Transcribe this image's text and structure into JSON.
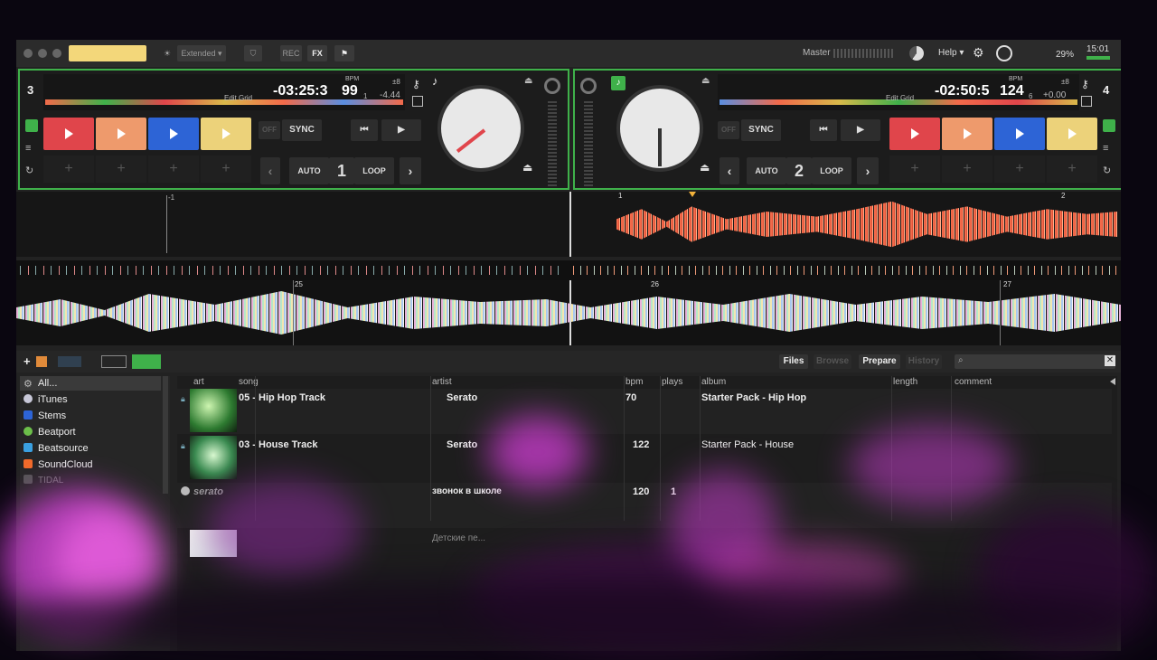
{
  "topbar": {
    "view_mode": "Extended",
    "rec": "REC",
    "fx": "FX",
    "master": "Master",
    "help": "Help",
    "battery": "29%",
    "clock": "15:01"
  },
  "deck_left": {
    "number": "3",
    "edit_grid": "Edit Grid",
    "time": "-03:25:3",
    "bpm_label": "BPM",
    "bpm": "99",
    "bpm_suffix": "1",
    "range": "±8",
    "pitch": "-4.44",
    "off": "OFF",
    "sync": "SYNC",
    "auto": "AUTO",
    "loop_num": "1",
    "loop": "LOOP",
    "pad_colors": [
      "#e0454b",
      "#ee9a6c",
      "#2d64d6",
      "#ecd27a"
    ]
  },
  "deck_right": {
    "number": "4",
    "edit_grid": "Edit Grid",
    "time": "-02:50:5",
    "bpm_label": "BPM",
    "bpm": "124",
    "bpm_suffix": "6",
    "range": "±8",
    "pitch": "+0.00",
    "off": "OFF",
    "sync": "SYNC",
    "auto": "AUTO",
    "loop_num": "2",
    "loop": "LOOP",
    "pad_colors": [
      "#e0454b",
      "#ee9a6c",
      "#2d64d6",
      "#ecd27a"
    ]
  },
  "waveform": {
    "left_beat_marker": "-1",
    "right_beat_marker_1": "1",
    "right_beat_marker_2": "2",
    "overview_marks": [
      "25",
      "26",
      "27"
    ]
  },
  "library": {
    "tabs": {
      "files": "Files",
      "browse": "Browse",
      "prepare": "Prepare",
      "history": "History"
    },
    "search_placeholder": "",
    "sidebar": [
      "All...",
      "iTunes",
      "Stems",
      "Beatport",
      "Beatsource",
      "SoundCloud",
      "TIDAL"
    ],
    "columns": [
      "art",
      "song",
      "artist",
      "bpm",
      "plays",
      "album",
      "length",
      "comment"
    ],
    "rows": [
      {
        "song": "05 - Hip Hop Track",
        "artist": "Serato",
        "bpm": "70",
        "plays": "",
        "album": "Starter Pack - Hip Hop"
      },
      {
        "song": "03 - House Track",
        "artist": "Serato",
        "bpm": "122",
        "plays": "",
        "album": "Starter Pack - House"
      },
      {
        "song": "",
        "artist": "звонок в школе",
        "bpm": "120",
        "plays": "1",
        "album": ""
      },
      {
        "song": "",
        "artist": "Детские пе...",
        "bpm": "",
        "plays": "",
        "album": ""
      }
    ],
    "row3_art_label": "serato"
  },
  "colors": {
    "accent": "#3fb14a",
    "waveform_hot": "#f26a4a",
    "yellow_tab": "#f3d77a"
  }
}
